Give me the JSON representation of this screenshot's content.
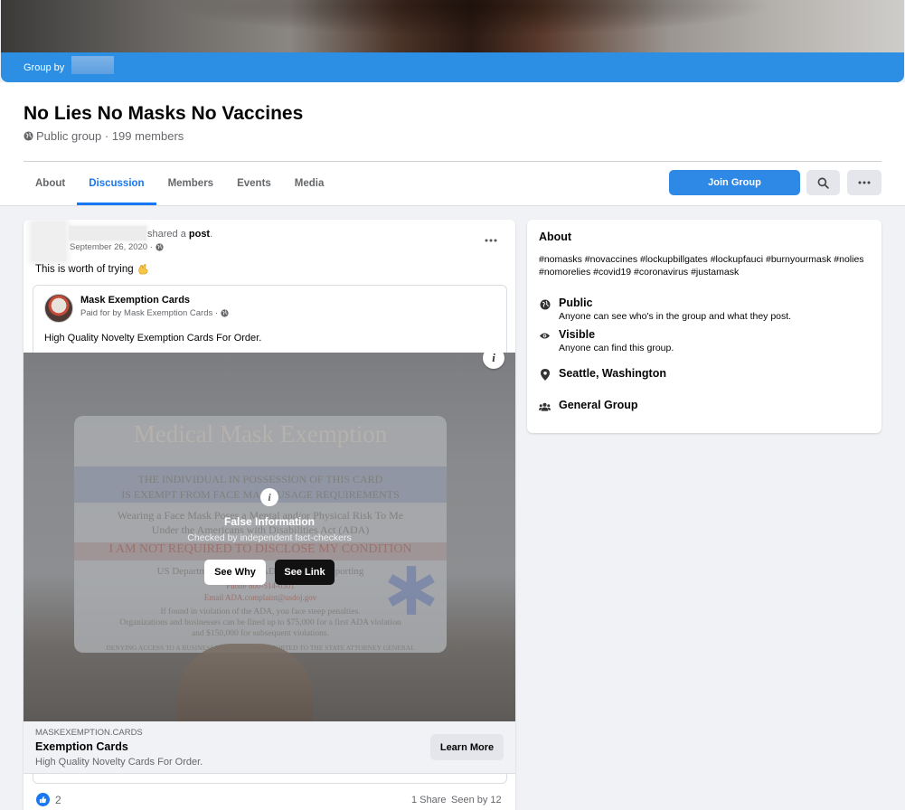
{
  "cover": {
    "group_by_label": "Group by"
  },
  "group": {
    "title": "No Lies No Masks No Vaccines",
    "meta": "Public group · 199 members"
  },
  "tabs": [
    {
      "label": "About"
    },
    {
      "label": "Discussion"
    },
    {
      "label": "Members"
    },
    {
      "label": "Events"
    },
    {
      "label": "Media"
    }
  ],
  "actions": {
    "join_label": "Join Group"
  },
  "post": {
    "shared_prefix": "shared a",
    "shared_object": "post",
    "shared_suffix": ".",
    "date": "September 26, 2020 ·",
    "text": "This is worth of trying",
    "shared": {
      "page_name": "Mask Exemption Cards",
      "paid_for": "Paid for by Mask Exemption Cards ·",
      "text": "High Quality Novelty Exemption Cards For Order.",
      "image_text": {
        "card_title": "Medical Mask Exemption",
        "line1": "THE INDIVIDUAL IN POSSESSION OF THIS CARD",
        "line2": "IS EXEMPT FROM FACE MASK USAGE REQUIREMENTS",
        "line3": "Wearing a Face Mask Poses a Mental and/or Physical Risk To Me",
        "line4": "Under the Americans with Disabilities Act (ADA)",
        "line5": "I AM NOT REQUIRED TO DISCLOSE MY CONDITION",
        "line6": "US Department of Justice ADA Violation Reporting",
        "line7": "Phone 800-514-0301",
        "line8": "Email ADA.complaint@usdoj.gov",
        "line9": "If found in violation of the ADA, you face steep penalties.",
        "line10": "Organizations and businesses can be fined up to $75,000 for a first ADA violation",
        "line11": "and $150,000 for subsequent violations.",
        "line12": "DENYING ACCESS TO A BUSINESS WILL ALSO BE REPORTED TO THE STATE ATTORNEY GENERAL"
      },
      "overlay": {
        "title": "False Information",
        "subtitle": "Checked by independent fact-checkers",
        "see_why": "See Why",
        "see_link": "See Link"
      },
      "link": {
        "domain": "MASKEXEMPTION.CARDS",
        "title": "Exemption Cards",
        "description": "High Quality Novelty Cards For Order.",
        "cta": "Learn More"
      }
    },
    "likes": "2",
    "shares": "1 Share",
    "seen_by": "Seen by 12"
  },
  "about": {
    "title": "About",
    "tags": "#nomasks #novaccines #lockupbillgates #lockupfauci #burnyourmask #nolies #nomorelies #covid19 #coronavirus #justamask",
    "privacy_title": "Public",
    "privacy_desc": "Anyone can see who's in the group and what they post.",
    "visibility_title": "Visible",
    "visibility_desc": "Anyone can find this group.",
    "location": "Seattle, Washington",
    "type": "General Group"
  },
  "colors": {
    "accent": "#1877f2",
    "cover_bar": "#2d8fe3",
    "join_button": "#2d88e6"
  }
}
